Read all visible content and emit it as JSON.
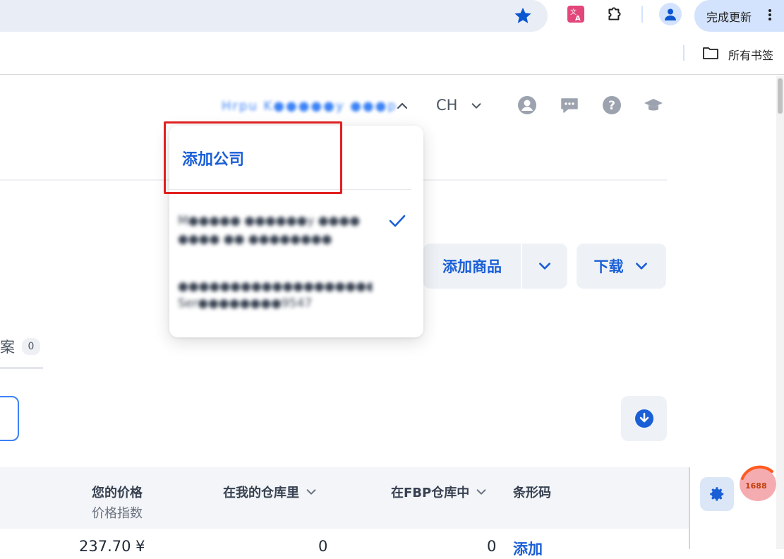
{
  "browser": {
    "update_button_label": "完成更新",
    "bookmarks_folder_label": "所有书签",
    "icons": [
      "star-icon",
      "translate-extension-icon",
      "extensions-puzzle-icon",
      "profile-icon",
      "more-menu-icon",
      "folder-icon"
    ],
    "accent_color": "#0b57d0"
  },
  "header": {
    "company_name_blurred": "Hrpu K●●●●●y ●●●p",
    "language": "CH",
    "icons": [
      "user-circle-icon",
      "chat-icon",
      "help-icon",
      "graduation-cap-icon"
    ]
  },
  "company_dropdown": {
    "add_company_label": "添加公司",
    "companies": [
      {
        "name_blurred": "M●●●●● ●●●●●●y ●●●●",
        "subtitle_blurred": "●●●● ●● ●●●●●●●●",
        "selected": true
      },
      {
        "name_blurred": "●●●●●●●●●●●●●●●●●●●●●●●ИП",
        "subtitle_blurred": "Ser●●●●●●●●9547",
        "selected": false
      }
    ]
  },
  "actions": {
    "add_product_label": "添加商品",
    "download_label": "下载"
  },
  "tabs": {
    "partial_label": "档案",
    "partial_count": "0"
  },
  "table": {
    "headers": {
      "your_price": "您的价格",
      "price_index": "价格指数",
      "in_my_warehouse": "在我的仓库里",
      "in_fbp_warehouse": "在FBP仓库中",
      "barcode": "条形码"
    },
    "first_row": {
      "price": "237.70 ¥",
      "my_warehouse_qty": "0",
      "fbp_qty": "0",
      "barcode_action": "添加"
    }
  },
  "overlay_badge": "1688",
  "colors": {
    "primary_blue": "#1a5fd6",
    "button_bg": "#eef2f7",
    "highlight_red": "#e02020"
  }
}
